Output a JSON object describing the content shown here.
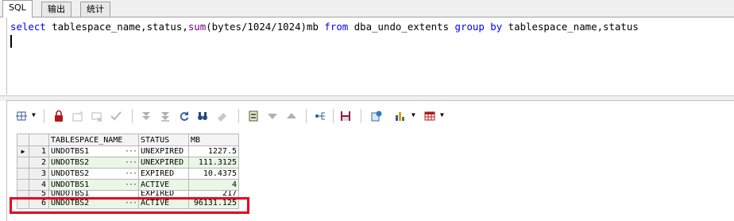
{
  "tabs": [
    {
      "label": "SQL",
      "active": true
    },
    {
      "label": "输出",
      "active": false
    },
    {
      "label": "统计",
      "active": false
    }
  ],
  "editor": {
    "tokens": [
      {
        "text": "select",
        "cls": "kw"
      },
      {
        "text": " tablespace_name,status,",
        "cls": "plain"
      },
      {
        "text": "sum",
        "cls": "fn"
      },
      {
        "text": "(bytes/1024/1024)mb ",
        "cls": "plain"
      },
      {
        "text": "from",
        "cls": "kw"
      },
      {
        "text": " dba_undo_extents ",
        "cls": "plain"
      },
      {
        "text": "group by",
        "cls": "kw"
      },
      {
        "text": " tablespace_name,status",
        "cls": "plain"
      }
    ]
  },
  "toolbar": {
    "icons": [
      "grid-layout-icon",
      "lock-icon",
      "add-row-icon",
      "delete-row-icon",
      "post-check-icon",
      "first-record-icon",
      "last-record-icon",
      "refresh-icon",
      "find-icon",
      "clear-icon",
      "single-record-view-icon",
      "sort-desc-icon",
      "sort-asc-icon",
      "export-icon",
      "save-icon",
      "query-icon",
      "chart-icon",
      "table-view-icon"
    ]
  },
  "grid": {
    "columns": [
      "TABLESPACE_NAME",
      "STATUS",
      "MB"
    ],
    "rows": [
      {
        "num": "1",
        "name": "UNDOTBS1",
        "status": "UNEXPIRED",
        "mb": "1227.5"
      },
      {
        "num": "2",
        "name": "UNDOTBS2",
        "status": "UNEXPIRED",
        "mb": "111.3125"
      },
      {
        "num": "3",
        "name": "UNDOTBS2",
        "status": "EXPIRED",
        "mb": "10.4375"
      },
      {
        "num": "4",
        "name": "UNDOTBS1",
        "status": "ACTIVE",
        "mb": "4"
      },
      {
        "num": "5",
        "name": "UNDOTBS1",
        "status": "EXPIRED",
        "mb": "217"
      },
      {
        "num": "6",
        "name": "UNDOTBS2",
        "status": "ACTIVE",
        "mb": "96131.125"
      }
    ],
    "cell_button": "···",
    "current_row_marker": "▶"
  },
  "colors": {
    "keyword": "#0000ff",
    "function": "#7a0080",
    "alt_row": "#eaf7e6",
    "highlight": "#e8001c"
  }
}
